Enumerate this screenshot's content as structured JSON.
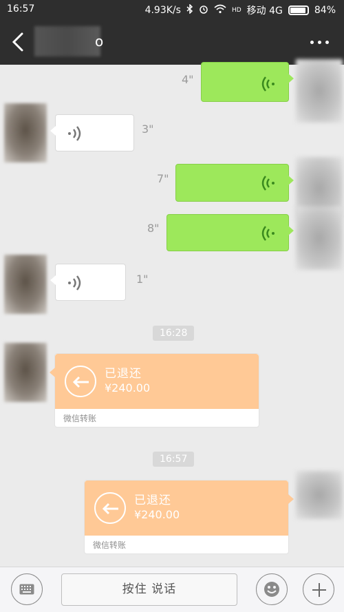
{
  "status_bar": {
    "time": "16:57",
    "network_speed": "4.93K/s",
    "carrier": "移动 4G",
    "battery": "84%",
    "icons": [
      "bluetooth-icon",
      "alarm-icon",
      "wifi-icon",
      "hd-icon",
      "battery-icon"
    ]
  },
  "title_bar": {
    "contact_name_suffix": "о"
  },
  "messages": {
    "voice_durations": [
      "4\"",
      "3\"",
      "7\"",
      "8\"",
      "1\""
    ],
    "timestamps": [
      "16:28",
      "16:57"
    ],
    "transfer_status": "已退还",
    "transfer_amount": "¥240.00",
    "transfer_label": "微信转账"
  },
  "bottom_bar": {
    "talk_label": "按住 说话"
  },
  "colors": {
    "header": "#2e2e2e",
    "sent_bubble": "#9de85b",
    "transfer": "#ffc996",
    "background": "#ebebeb"
  }
}
